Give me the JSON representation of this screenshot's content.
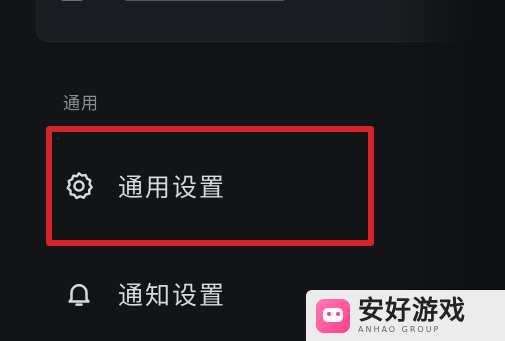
{
  "sidebar": {
    "section_label": "通用",
    "items": [
      {
        "label": "通用设置",
        "icon": "gear-icon",
        "highlighted": true
      },
      {
        "label": "通知设置",
        "icon": "bell-icon",
        "highlighted": false
      }
    ]
  },
  "watermark": {
    "main": "安好游戏",
    "sub": "ANHAO GROUP"
  },
  "colors": {
    "highlight": "#d8232a",
    "background": "#121418",
    "text": "#d7d9dc",
    "muted": "#8a8d92"
  }
}
